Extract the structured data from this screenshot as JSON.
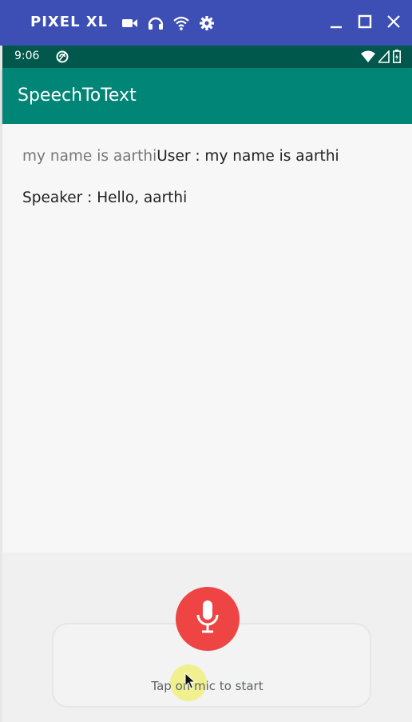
{
  "emulator": {
    "title": "PIXEL XL",
    "icons": [
      "video-camera-icon",
      "headphones-icon",
      "wifi-icon",
      "settings-icon"
    ],
    "controls": [
      "minimize-icon",
      "maximize-icon",
      "close-icon"
    ],
    "bar_color": "#3d4fb4"
  },
  "status_bar": {
    "time": "9:06",
    "icons": [
      "sync-icon",
      "wifi-signal-icon",
      "cell-signal-icon",
      "battery-icon"
    ],
    "color": "#00574b"
  },
  "app_bar": {
    "title": "SpeechToText",
    "color": "#008577"
  },
  "conversation": {
    "partial_transcript": "my name is aarthi",
    "user_line": "User : my name is aarthi",
    "speaker_line": "Speaker : Hello, aarthi"
  },
  "speech_input": {
    "hint": "Tap on mic to start",
    "mic_color": "#ef4444"
  }
}
